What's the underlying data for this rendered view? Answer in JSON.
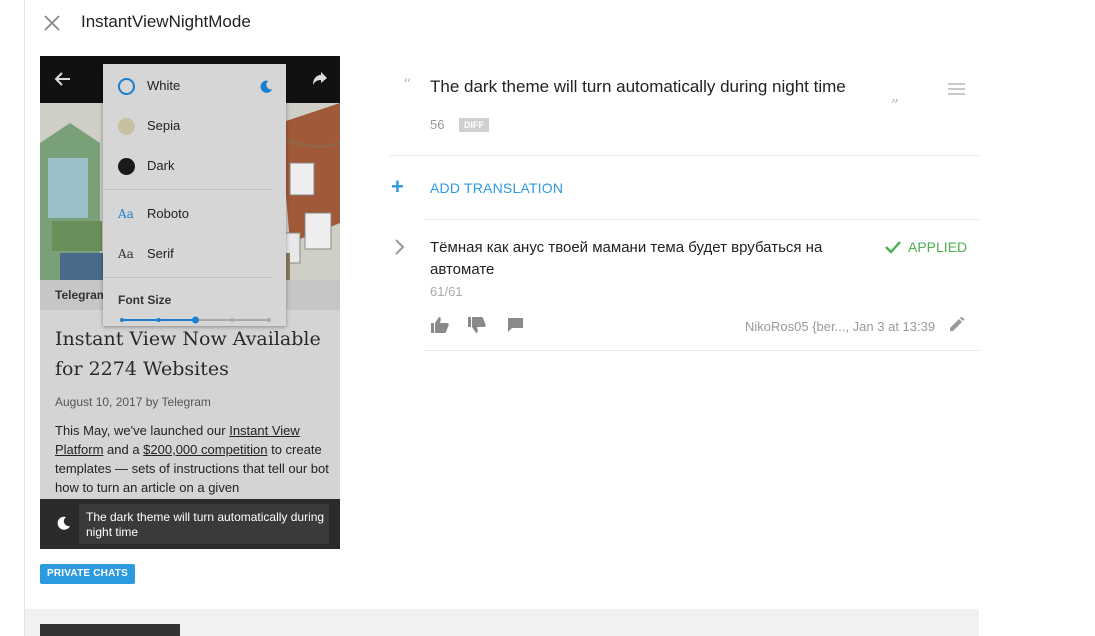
{
  "header": {
    "title": "InstantViewNightMode"
  },
  "preview": {
    "source_label": "Telegram",
    "headline": "Instant View Now Available for 2274 Websites",
    "meta": "August 10, 2017 by Telegram",
    "body": {
      "p1": "This May, we've launched our ",
      "link1": "Instant View Platform",
      "p2": " and a ",
      "link2": "$200,000 competition",
      "p3": " to create templates — sets of instructions that tell our bot how to turn an article on a given"
    },
    "menu": {
      "themes": [
        {
          "label": "White",
          "color": "#1a7fd0",
          "selected": true
        },
        {
          "label": "Sepia",
          "color": "#c8bfa0"
        },
        {
          "label": "Dark",
          "color": "#1a1a1a"
        }
      ],
      "fonts": [
        {
          "glyph": "Aa",
          "label": "Roboto",
          "selected": true
        },
        {
          "glyph": "Aa",
          "label": "Serif"
        }
      ],
      "font_size_label": "Font Size",
      "font_size_level": 3,
      "font_size_steps": 5
    },
    "toast": "The dark theme will turn automatically during night time"
  },
  "badge": "PRIVATE CHATS",
  "source": {
    "quote_open": "“",
    "text": "The dark theme will turn automatically during night time",
    "quote_close": "„",
    "char_count": "56",
    "diff_label": "DIFF"
  },
  "add_translation": {
    "plus": "+",
    "label": "ADD TRANSLATION"
  },
  "translation": {
    "text": "Тёмная как анус твоей мамани тема будет врубаться на автомате",
    "status": "APPLIED",
    "char_count": "61/61",
    "author": "NikoRos05 {ber..., Jan 3 at 13:39"
  },
  "colors": {
    "accent": "#2c9ae0",
    "applied": "#4caf50",
    "icon_grey": "#8a8a8a"
  }
}
